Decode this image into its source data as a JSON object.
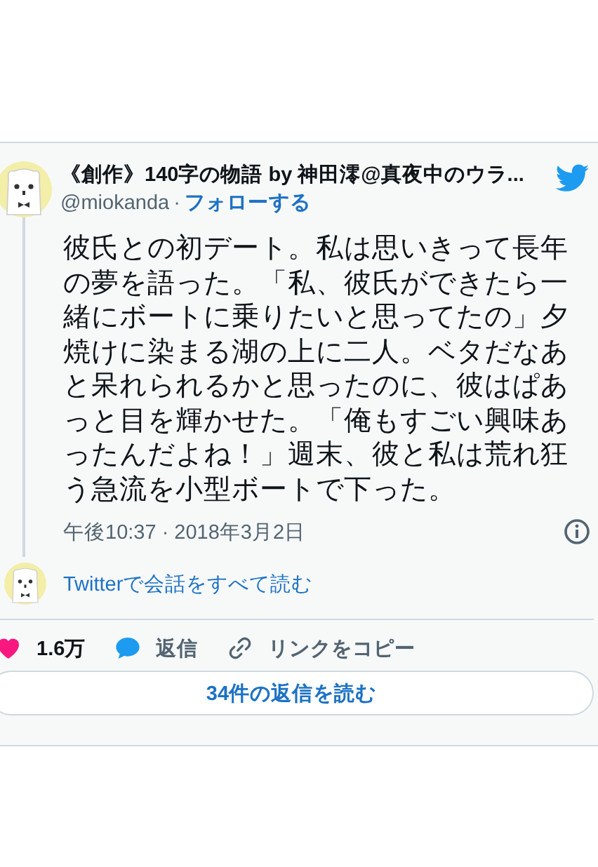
{
  "tweet": {
    "author": {
      "name": "《創作》140字の物語 by 神田澪@真夜中のウラ...",
      "handle": "@miokanda",
      "separator": "·",
      "follow": "フォローする"
    },
    "text": "彼氏との初デート。私は思いきって長年の夢を語った。「私、彼氏ができたら一緒にボートに乗りたいと思ってたの」夕焼けに染まる湖の上に二人。ベタだなあと呆れられるかと思ったのに、彼はぱあっと目を輝かせた。「俺もすごい興味あったんだよね！」週末、彼と私は荒れ狂う急流を小型ボートで下った。",
    "timestamp": "午後10:37 · 2018年3月2日",
    "conversation_link": "Twitterで会話をすべて読む",
    "actions": [
      {
        "kind": "like",
        "label": "1.6万"
      },
      {
        "kind": "reply",
        "label": "返信"
      },
      {
        "kind": "copy",
        "label": "リンクをコピー"
      }
    ],
    "replies_button": "34件の返信を読む"
  }
}
